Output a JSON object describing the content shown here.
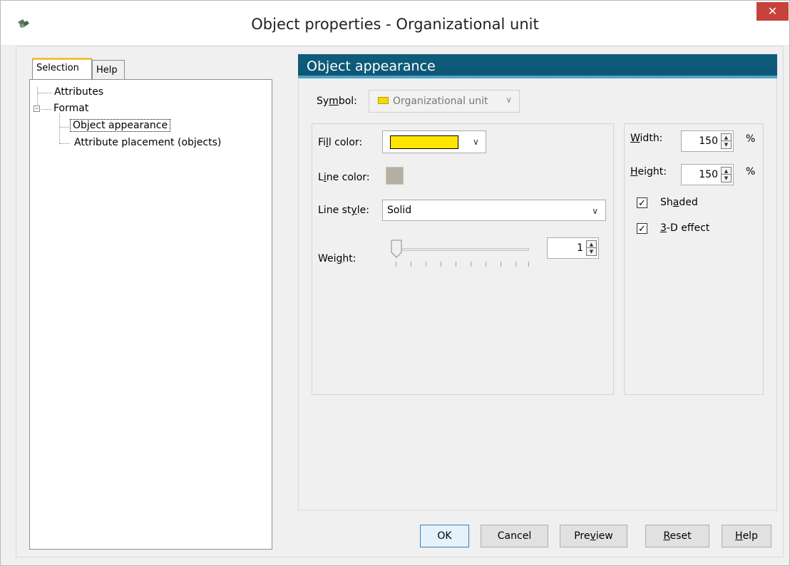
{
  "window": {
    "title": "Object properties - Organizational unit",
    "close_glyph": "✕",
    "app_icon": "app-logo-icon"
  },
  "left": {
    "tabs": [
      {
        "label": "Selection",
        "active": true
      },
      {
        "label": "Help",
        "active": false
      }
    ],
    "tree": {
      "attributes": "Attributes",
      "format": "Format",
      "format_expander": "−",
      "object_appearance": "Object appearance",
      "attribute_placement": "Attribute placement (objects)"
    }
  },
  "main": {
    "section_title": "Object appearance",
    "symbol": {
      "label": "Symbol:",
      "value": "Organizational unit",
      "color": "#f7d900"
    },
    "fill_color": {
      "label": "Fill color:",
      "value": "#ffe600"
    },
    "line_color": {
      "label": "Line color:",
      "value": "#b4afa0"
    },
    "line_style": {
      "label": "Line style:",
      "value": "Solid"
    },
    "weight": {
      "label": "Weight:",
      "value": "1",
      "slider_fraction": 0
    },
    "width": {
      "label": "Width:",
      "value": "150",
      "unit": "%"
    },
    "height": {
      "label": "Height:",
      "value": "150",
      "unit": "%"
    },
    "shaded": {
      "label": "Shaded",
      "checked": true
    },
    "effect3d": {
      "label": "3-D effect",
      "checked": true
    }
  },
  "buttons": {
    "ok": "OK",
    "cancel": "Cancel",
    "preview": "Preview",
    "reset": "Reset",
    "help": "Help"
  },
  "colors": {
    "header_bg": "#0f5c7b",
    "close_bg": "#c7423a",
    "tab_accent": "#f5c040"
  }
}
